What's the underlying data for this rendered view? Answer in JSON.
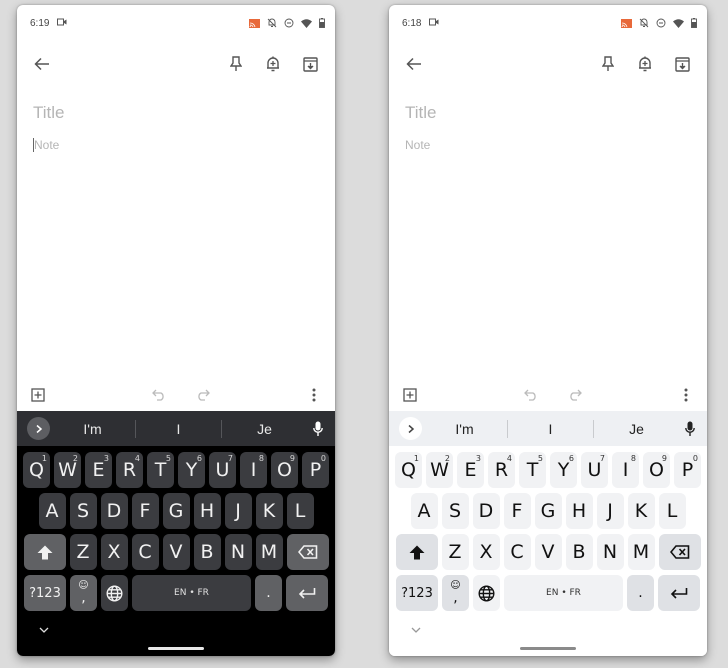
{
  "screens": [
    {
      "theme": "dark",
      "status_bar": {
        "time": "6:19",
        "icons": [
          "video-camera-icon",
          "cast-icon",
          "notifications-off-icon",
          "do-not-disturb-icon",
          "wifi-icon",
          "battery-icon"
        ]
      },
      "app_bar": {
        "back": "back-arrow-icon",
        "actions": [
          "pin-icon",
          "reminder-bell-icon",
          "archive-icon"
        ]
      },
      "note": {
        "title_placeholder": "Title",
        "body_placeholder": "Note"
      },
      "bottom_bar": {
        "left": "add-box-icon",
        "middle": [
          "undo-icon",
          "redo-icon"
        ],
        "right": "more-vert-icon"
      },
      "keyboard": {
        "suggestions": [
          "I'm",
          "I",
          "Je"
        ],
        "row1": [
          {
            "key": "Q",
            "hint": "1"
          },
          {
            "key": "W",
            "hint": "2"
          },
          {
            "key": "E",
            "hint": "3"
          },
          {
            "key": "R",
            "hint": "4"
          },
          {
            "key": "T",
            "hint": "5"
          },
          {
            "key": "Y",
            "hint": "6"
          },
          {
            "key": "U",
            "hint": "7"
          },
          {
            "key": "I",
            "hint": "8"
          },
          {
            "key": "O",
            "hint": "9"
          },
          {
            "key": "P",
            "hint": "0"
          }
        ],
        "row2": [
          "A",
          "S",
          "D",
          "F",
          "G",
          "H",
          "J",
          "K",
          "L"
        ],
        "row3": [
          "Z",
          "X",
          "C",
          "V",
          "B",
          "N",
          "M"
        ],
        "symbols_label": "?123",
        "comma_label": ",",
        "emoji_label": "☺",
        "space_label": "EN • FR",
        "period_label": "."
      }
    },
    {
      "theme": "light",
      "status_bar": {
        "time": "6:18",
        "icons": [
          "video-camera-icon",
          "cast-icon",
          "notifications-off-icon",
          "do-not-disturb-icon",
          "wifi-icon",
          "battery-icon"
        ]
      },
      "app_bar": {
        "back": "back-arrow-icon",
        "actions": [
          "pin-icon",
          "reminder-bell-icon",
          "archive-icon"
        ]
      },
      "note": {
        "title_placeholder": "Title",
        "body_placeholder": "Note"
      },
      "bottom_bar": {
        "left": "add-box-icon",
        "middle": [
          "undo-icon",
          "redo-icon"
        ],
        "right": "more-vert-icon"
      },
      "keyboard": {
        "suggestions": [
          "I'm",
          "I",
          "Je"
        ],
        "row1": [
          {
            "key": "Q",
            "hint": "1"
          },
          {
            "key": "W",
            "hint": "2"
          },
          {
            "key": "E",
            "hint": "3"
          },
          {
            "key": "R",
            "hint": "4"
          },
          {
            "key": "T",
            "hint": "5"
          },
          {
            "key": "Y",
            "hint": "6"
          },
          {
            "key": "U",
            "hint": "7"
          },
          {
            "key": "I",
            "hint": "8"
          },
          {
            "key": "O",
            "hint": "9"
          },
          {
            "key": "P",
            "hint": "0"
          }
        ],
        "row2": [
          "A",
          "S",
          "D",
          "F",
          "G",
          "H",
          "J",
          "K",
          "L"
        ],
        "row3": [
          "Z",
          "X",
          "C",
          "V",
          "B",
          "N",
          "M"
        ],
        "symbols_label": "?123",
        "comma_label": ",",
        "emoji_label": "☺",
        "space_label": "EN • FR",
        "period_label": "."
      }
    }
  ],
  "colors": {
    "cast_accent": "#e8693a",
    "dark_key": "#3b3c40",
    "dark_fn_key": "#606164",
    "light_key": "#f1f2f4",
    "light_fn_key": "#dfe1e5"
  }
}
